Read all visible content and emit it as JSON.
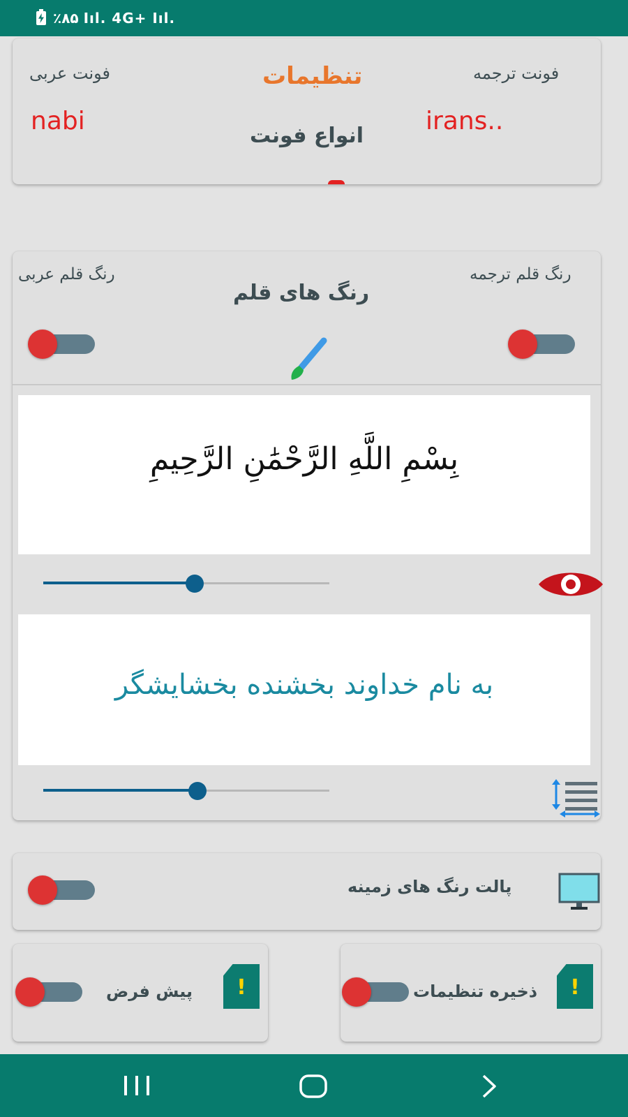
{
  "status_bar": {
    "text": "٪۸۵ Iıl. 4G+ Iıl."
  },
  "fonts_card": {
    "title": "تنظیمات",
    "subtitle": "انواع فونت",
    "arabic_font_label": "فونت عربی",
    "arabic_font_value": "nabi",
    "translation_font_label": "فونت ترجمه",
    "translation_font_value": "irans.."
  },
  "pen_colors_card": {
    "title": "رنگ های قلم",
    "arabic_pen_label": "رنگ قلم عربی",
    "translation_pen_label": "رنگ قلم ترجمه"
  },
  "preview": {
    "arabic_text": "بِسْمِ اللَّهِ الرَّحْمَٰنِ الرَّحِيمِ",
    "translation_text": "به نام خداوند بخشنده بخشایشگر",
    "arabic_size_slider": 0.53,
    "translation_size_slider": 0.54
  },
  "background_card": {
    "label": "پالت رنگ های زمینه"
  },
  "bottom_cards": {
    "default_label": "پیش فرض",
    "save_label": "ذخیره تنظیمات"
  },
  "colors": {
    "teal": "#077b6d",
    "title_orange": "#e8762c",
    "font_value_red": "#e32222",
    "toggle_knob": "#dd3333",
    "translation_text": "#1a8aa0",
    "slider_blue": "#0d5f8c",
    "eye_red": "#c4141c"
  }
}
